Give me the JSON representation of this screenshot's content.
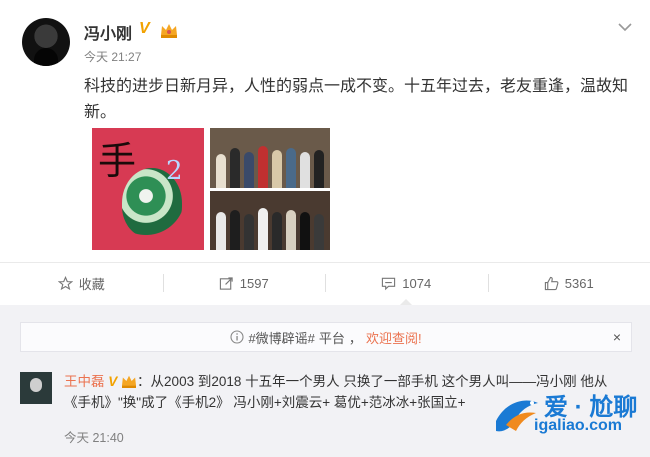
{
  "post": {
    "author": "冯小刚",
    "verified": "V",
    "time": "今天 21:27",
    "text": "科技的进步日新月异，人性的弱点一成不变。十五年过去，老友重逢，温故知新。"
  },
  "actions": [
    {
      "icon": "star-icon",
      "label": "收藏"
    },
    {
      "icon": "repost-icon",
      "label": "1597"
    },
    {
      "icon": "comment-icon",
      "label": "1074"
    },
    {
      "icon": "like-icon",
      "label": "5361"
    }
  ],
  "notice": {
    "tag1": "#微博辟谣#",
    "tag2": "平台",
    "sep": "，",
    "link": "欢迎查阅!",
    "close": "×"
  },
  "comment": {
    "author": "王中磊",
    "verified": "V",
    "text": "：从2003 到2018 十五年一个男人 只换了一部手机 这个男人叫——冯小刚 他从《手机》\"换\"成了《手机2》 冯小刚+刘震云+ 葛优+范冰冰+张国立+",
    "time": "今天 21:40"
  },
  "watermark": {
    "title": "爱 · 尬聊",
    "url": "igaliao.com"
  },
  "colors": {
    "accent": "#eb7350",
    "verified": "#f2a200",
    "watermark": "#1a7ad4"
  }
}
